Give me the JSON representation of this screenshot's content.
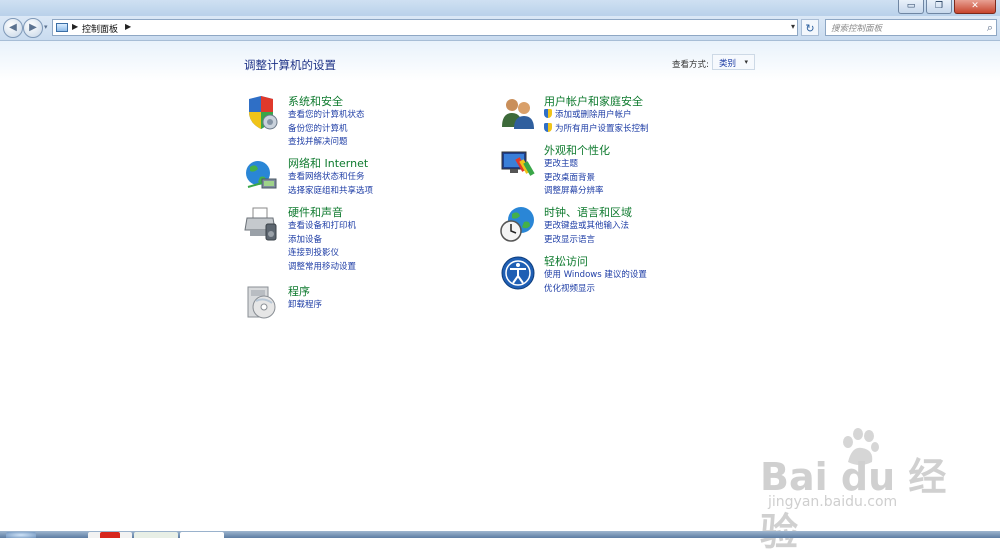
{
  "window": {
    "minimize_glyph": "▭",
    "maximize_glyph": "❐",
    "close_glyph": "✕"
  },
  "nav": {
    "back_glyph": "◀",
    "forward_glyph": "▶",
    "recent_glyph": "▾",
    "arrow_glyph": "▶",
    "breadcrumb": "控制面板",
    "dropdown_glyph": "▾",
    "refresh_glyph": "↻",
    "search_placeholder": "搜索控制面板",
    "search_glyph": "⌕"
  },
  "page": {
    "title": "调整计算机的设置",
    "view_by_label": "查看方式:",
    "view_by_value": "类别",
    "view_by_arrow": "▾"
  },
  "categories": [
    {
      "title": "系统和安全",
      "links": [
        "查看您的计算机状态",
        "备份您的计算机",
        "查找并解决问题"
      ],
      "icon": "shield-icon"
    },
    {
      "title": "网络和 Internet",
      "links": [
        "查看网络状态和任务",
        "选择家庭组和共享选项"
      ],
      "icon": "network-globe-icon"
    },
    {
      "title": "硬件和声音",
      "links": [
        "查看设备和打印机",
        "添加设备",
        "连接到投影仪",
        "调整常用移动设置"
      ],
      "icon": "printer-icon"
    },
    {
      "title": "程序",
      "links": [
        "卸载程序"
      ],
      "icon": "programs-disc-icon"
    },
    {
      "title": "用户帐户和家庭安全",
      "links": [
        "添加或删除用户帐户",
        "为所有用户设置家长控制"
      ],
      "icon": "users-icon"
    },
    {
      "title": "外观和个性化",
      "links": [
        "更改主题",
        "更改桌面背景",
        "调整屏幕分辨率"
      ],
      "icon": "display-brush-icon"
    },
    {
      "title": "时钟、语言和区域",
      "links": [
        "更改键盘或其他输入法",
        "更改显示语言"
      ],
      "icon": "clock-globe-icon"
    },
    {
      "title": "轻松访问",
      "links": [
        "使用 Windows 建议的设置",
        "优化视频显示"
      ],
      "icon": "ease-of-access-icon"
    }
  ],
  "watermark": {
    "brand": "Bai du 经验",
    "url": "jingyan.baidu.com"
  }
}
